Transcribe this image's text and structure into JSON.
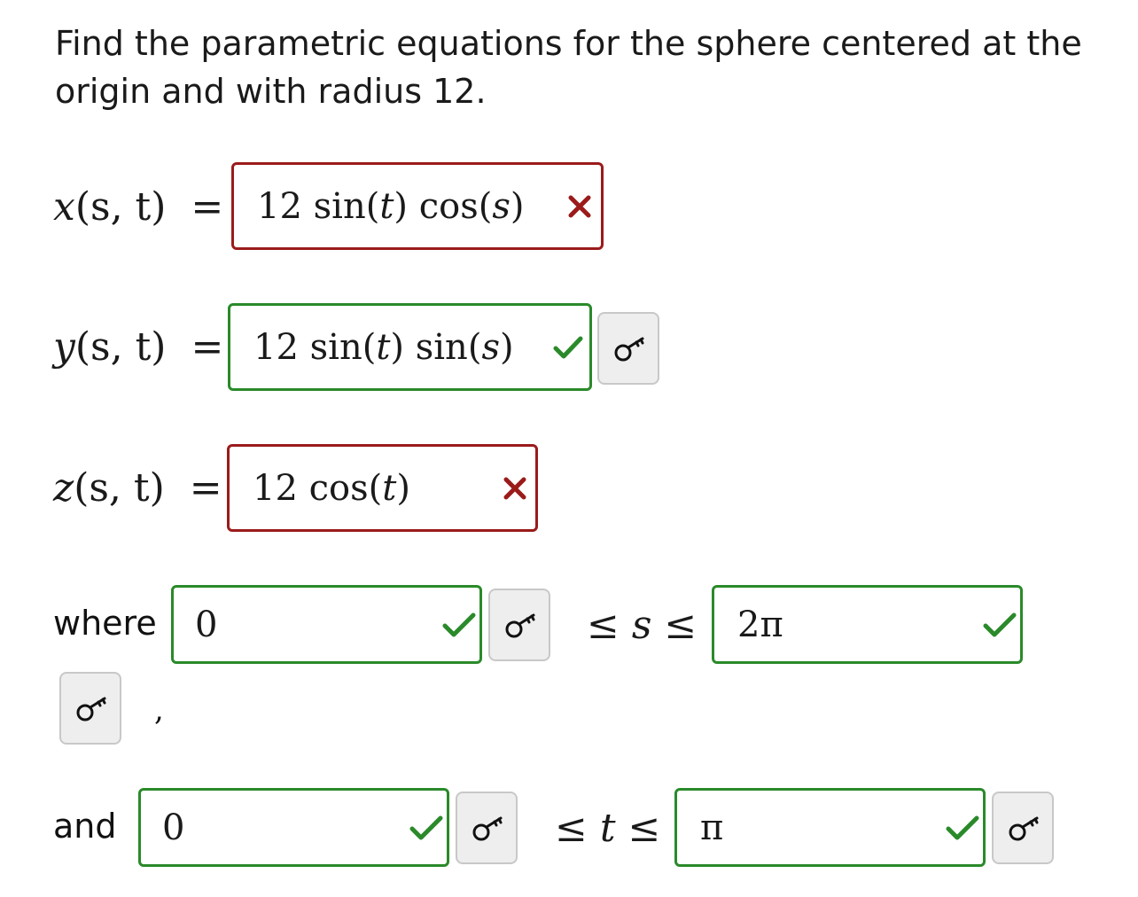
{
  "question": "Find the parametric equations for the sphere centered at the origin and with radius 12.",
  "colors": {
    "correct": "#2a8a2a",
    "incorrect": "#9b1b1b",
    "key_button_bg": "#eeeeee"
  },
  "equations": [
    {
      "var": "x",
      "args": "(s, t)",
      "equals": "=",
      "coef": "12",
      "f1": "sin",
      "a1": "t",
      "f2": "cos",
      "a2": "s",
      "status": "incorrect",
      "status_icon": "cross-icon"
    },
    {
      "var": "y",
      "args": "(s, t)",
      "equals": "=",
      "coef": "12",
      "f1": "sin",
      "a1": "t",
      "f2": "sin",
      "a2": "s",
      "status": "correct",
      "status_icon": "check-icon"
    },
    {
      "var": "z",
      "args": "(s, t)",
      "equals": "=",
      "coef": "12",
      "f1": "cos",
      "a1": "t",
      "status": "incorrect",
      "status_icon": "cross-icon"
    }
  ],
  "where_label": "where",
  "and_label": "and",
  "comma": ",",
  "s_range": {
    "lower": "0",
    "symbol": "≤ s ≤",
    "upper": "2π",
    "lower_status": "correct",
    "upper_status": "correct"
  },
  "t_range": {
    "lower": "0",
    "symbol": "≤ t ≤",
    "upper": "π",
    "lower_status": "correct",
    "upper_status": "correct"
  },
  "key_icon": "key-icon"
}
